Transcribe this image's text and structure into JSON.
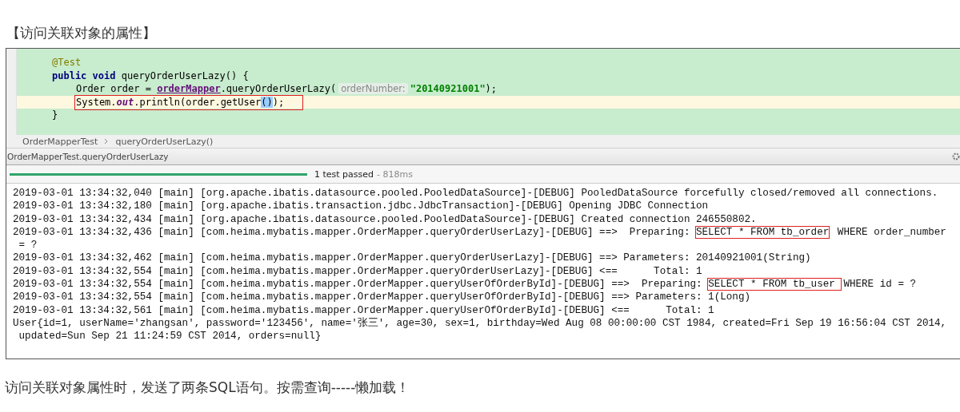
{
  "heading": "【访问关联对象的属性】",
  "editor": {
    "lines": [
      {
        "current": false,
        "boxed": false,
        "tokens": [
          {
            "kind": "annotation",
            "text": "@Test"
          }
        ]
      },
      {
        "current": false,
        "boxed": false,
        "tokens": [
          {
            "kind": "keyword",
            "text": "public void "
          },
          {
            "kind": "plain",
            "text": "queryOrderUserLazy() {"
          }
        ]
      },
      {
        "current": false,
        "boxed": false,
        "tokens": [
          {
            "kind": "plain",
            "text": "Order order = "
          },
          {
            "kind": "field",
            "text": "orderMapper"
          },
          {
            "kind": "plain",
            "text": ".queryOrderUserLazy("
          },
          {
            "kind": "hint",
            "text": "orderNumber:"
          },
          {
            "kind": "string",
            "text": "\"20140921001\""
          },
          {
            "kind": "plain",
            "text": ");"
          }
        ]
      },
      {
        "current": true,
        "boxed": true,
        "tokens": [
          {
            "kind": "plain",
            "text": "System."
          },
          {
            "kind": "static",
            "text": "out"
          },
          {
            "kind": "plain",
            "text": ".println(order.getUser"
          },
          {
            "kind": "brace",
            "text": "()"
          },
          {
            "kind": "plain",
            "text": ");"
          }
        ]
      },
      {
        "current": false,
        "boxed": false,
        "tokens": [
          {
            "kind": "plain",
            "text": "}"
          }
        ]
      }
    ]
  },
  "breadcrumb": [
    {
      "text": "OrderMapperTest"
    },
    {
      "text": "queryOrderUserLazy()"
    }
  ],
  "run_tab": "OrderMapperTest.queryOrderUserLazy",
  "progress": {
    "level": 1,
    "status": "1 test passed",
    "time": "- 818ms"
  },
  "console": [
    {
      "kind": "plain",
      "text": "2019-03-01 13:34:32,040 [main] [org.apache.ibatis.datasource.pooled.PooledDataSource]-[DEBUG] PooledDataSource forcefully closed/removed all connections."
    },
    {
      "kind": "plain",
      "text": "2019-03-01 13:34:32,180 [main] [org.apache.ibatis.transaction.jdbc.JdbcTransaction]-[DEBUG] Opening JDBC Connection"
    },
    {
      "kind": "plain",
      "text": "2019-03-01 13:34:32,434 [main] [org.apache.ibatis.datasource.pooled.PooledDataSource]-[DEBUG] Created connection 246550802."
    },
    {
      "kind": "sql",
      "text": "2019-03-01 13:34:32,436 [main] [com.heima.mybatis.mapper.OrderMapper.queryOrderUserLazy]-[DEBUG] ==>  Preparing: ",
      "sql": "SELECT * FROM tb_order",
      "rest": " WHERE order_number"
    },
    {
      "kind": "plain",
      "text": " = ?"
    },
    {
      "kind": "plain",
      "text": "2019-03-01 13:34:32,462 [main] [com.heima.mybatis.mapper.OrderMapper.queryOrderUserLazy]-[DEBUG] ==> Parameters: 20140921001(String)"
    },
    {
      "kind": "plain",
      "text": "2019-03-01 13:34:32,554 [main] [com.heima.mybatis.mapper.OrderMapper.queryOrderUserLazy]-[DEBUG] <==      Total: 1"
    },
    {
      "kind": "sql",
      "text": "2019-03-01 13:34:32,554 [main] [com.heima.mybatis.mapper.OrderMapper.queryUserOfOrderById]-[DEBUG] ==>  Preparing: ",
      "sql": "SELECT * FROM tb_user ",
      "rest": "WHERE id = ?"
    },
    {
      "kind": "plain",
      "text": "2019-03-01 13:34:32,554 [main] [com.heima.mybatis.mapper.OrderMapper.queryUserOfOrderById]-[DEBUG] ==> Parameters: 1(Long)"
    },
    {
      "kind": "plain",
      "text": "2019-03-01 13:34:32,561 [main] [com.heima.mybatis.mapper.OrderMapper.queryUserOfOrderById]-[DEBUG] <==      Total: 1"
    },
    {
      "kind": "plain",
      "text": "User{id=1, userName='zhangsan', password='123456', name='张三', age=30, sex=1, birthday=Wed Aug 08 00:00:00 CST 1984, created=Fri Sep 19 16:56:04 CST 2014,"
    },
    {
      "kind": "plain",
      "text": " updated=Sun Sep 21 11:24:59 CST 2014, orders=null}"
    }
  ],
  "caption": "访问关联对象属性时，发送了两条SQL语句。按需查询-----懒加载！"
}
